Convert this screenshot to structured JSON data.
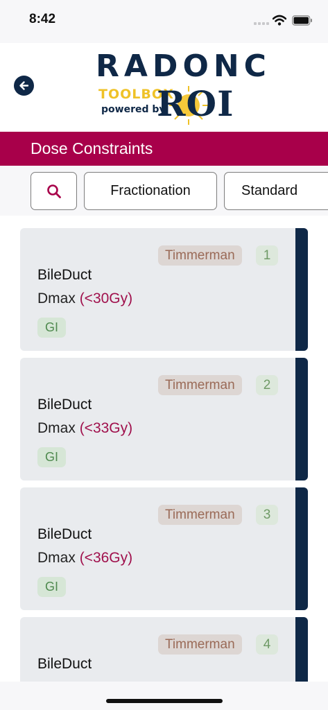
{
  "status_bar": {
    "time": "8:42"
  },
  "header": {
    "logo": {
      "line1": "RADONC",
      "line2": "TOOLBOX",
      "line3": "powered by",
      "brand": "ROI"
    }
  },
  "title": "Dose Constraints",
  "filters": {
    "fractionation_label": "Fractionation",
    "standard_label": "Standard"
  },
  "constraints": [
    {
      "source": "Timmerman",
      "count": "1",
      "structure": "BileDuct",
      "metric": "Dmax",
      "limit": "(<30Gy)",
      "tag": "GI"
    },
    {
      "source": "Timmerman",
      "count": "2",
      "structure": "BileDuct",
      "metric": "Dmax",
      "limit": "(<33Gy)",
      "tag": "GI"
    },
    {
      "source": "Timmerman",
      "count": "3",
      "structure": "BileDuct",
      "metric": "Dmax",
      "limit": "(<36Gy)",
      "tag": "GI"
    },
    {
      "source": "Timmerman",
      "count": "4",
      "structure": "BileDuct",
      "metric": "",
      "limit": "",
      "tag": ""
    }
  ],
  "colors": {
    "brand_navy": "#0f2847",
    "title_bar": "#a8004a",
    "logo_gold": "#efc228",
    "limit_text": "#a0104c",
    "tag_green": "#4f8a4f",
    "source_brown": "#9a6a57"
  },
  "icons": [
    "back-arrow-icon",
    "search-icon",
    "wifi-icon",
    "battery-icon",
    "signal-icon"
  ]
}
